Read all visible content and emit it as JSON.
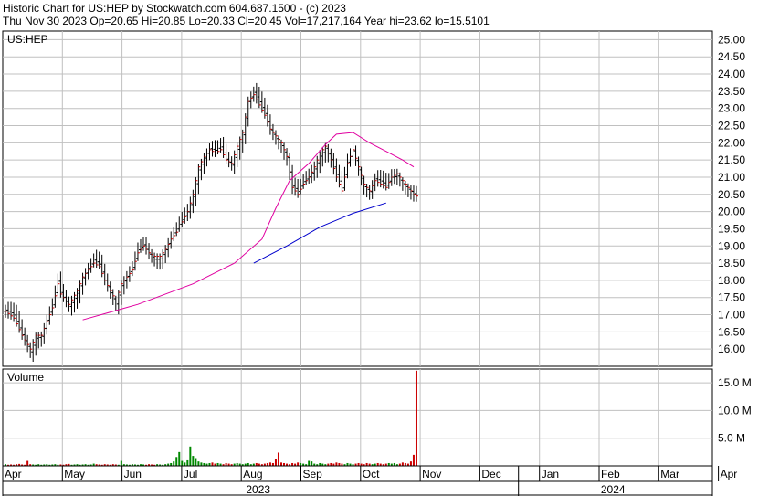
{
  "header": {
    "line1": "Historic Chart for US:HEP by Stockwatch.com 604.687.1500 - (c) 2023",
    "line2": "Thu Nov 30 2023  Op=20.65  Hi=20.85  Lo=20.33  Cl=20.45  Vol=17,217,164  Year hi=23.62  lo=15.5101"
  },
  "chart_data": {
    "type": "candlestick",
    "symbol_label": "US:HEP",
    "volume_label": "Volume",
    "price_axis": {
      "min": 15.5,
      "max": 25.25,
      "ticks": [
        "16.00",
        "16.50",
        "17.00",
        "17.50",
        "18.00",
        "18.50",
        "19.00",
        "19.50",
        "20.00",
        "20.50",
        "21.00",
        "21.50",
        "22.00",
        "22.50",
        "23.00",
        "23.50",
        "24.00",
        "24.50",
        "25.00"
      ]
    },
    "volume_axis": {
      "max_millions": 17.5,
      "ticks": [
        {
          "value": 5,
          "label": "5.0 M"
        },
        {
          "value": 10,
          "label": "10.0 M"
        },
        {
          "value": 15,
          "label": "15.0 M"
        }
      ]
    },
    "months": [
      "Apr",
      "May",
      "Jun",
      "Jul",
      "Aug",
      "Sep",
      "Oct",
      "Nov",
      "Dec",
      "Jan",
      "Feb",
      "Mar",
      "Apr"
    ],
    "years": [
      "2023",
      "2024"
    ],
    "grid": true,
    "price_path": [
      [
        0,
        17.1
      ],
      [
        3,
        16.9
      ],
      [
        6,
        16.4
      ],
      [
        9,
        16.0
      ],
      [
        11,
        16.4
      ],
      [
        13,
        16.4
      ],
      [
        15,
        16.8
      ],
      [
        17,
        17.2
      ],
      [
        19,
        17.9
      ],
      [
        20,
        17.6
      ],
      [
        23,
        17.3
      ],
      [
        26,
        17.7
      ],
      [
        28,
        18.1
      ],
      [
        30,
        18.3
      ],
      [
        32,
        18.5
      ],
      [
        34,
        18.4
      ],
      [
        36,
        18.0
      ],
      [
        38,
        17.7
      ],
      [
        40,
        17.4
      ],
      [
        42,
        17.9
      ],
      [
        44,
        18.1
      ],
      [
        46,
        18.3
      ],
      [
        48,
        18.8
      ],
      [
        50,
        19.0
      ],
      [
        52,
        18.8
      ],
      [
        54,
        18.7
      ],
      [
        56,
        18.7
      ],
      [
        58,
        18.9
      ],
      [
        60,
        19.2
      ],
      [
        62,
        19.4
      ],
      [
        64,
        19.7
      ],
      [
        66,
        20.0
      ],
      [
        68,
        20.5
      ],
      [
        70,
        21.3
      ],
      [
        72,
        21.6
      ],
      [
        74,
        21.8
      ],
      [
        76,
        21.7
      ],
      [
        78,
        21.8
      ],
      [
        80,
        21.5
      ],
      [
        82,
        21.4
      ],
      [
        84,
        21.9
      ],
      [
        86,
        22.3
      ],
      [
        88,
        23.2
      ],
      [
        90,
        23.4
      ],
      [
        92,
        23.1
      ],
      [
        94,
        22.8
      ],
      [
        96,
        22.4
      ],
      [
        98,
        22.2
      ],
      [
        100,
        22.0
      ],
      [
        102,
        21.6
      ],
      [
        104,
        20.7
      ],
      [
        106,
        20.5
      ],
      [
        108,
        20.8
      ],
      [
        110,
        21.0
      ],
      [
        112,
        21.3
      ],
      [
        114,
        21.7
      ],
      [
        116,
        21.9
      ],
      [
        118,
        21.5
      ],
      [
        120,
        21.0
      ],
      [
        122,
        20.6
      ],
      [
        124,
        21.4
      ],
      [
        126,
        21.8
      ],
      [
        128,
        21.3
      ],
      [
        130,
        20.8
      ],
      [
        132,
        20.6
      ],
      [
        134,
        20.9
      ],
      [
        136,
        20.8
      ],
      [
        138,
        20.7
      ],
      [
        140,
        21.0
      ],
      [
        142,
        21.1
      ],
      [
        144,
        20.9
      ],
      [
        146,
        20.7
      ],
      [
        148,
        20.5
      ],
      [
        149,
        20.45
      ]
    ],
    "ma_short": [
      [
        0,
        16.85
      ],
      [
        20,
        17.3
      ],
      [
        40,
        17.9
      ],
      [
        55,
        18.5
      ],
      [
        65,
        19.2
      ],
      [
        70,
        20.1
      ],
      [
        75,
        20.9
      ],
      [
        82,
        21.4
      ],
      [
        88,
        21.95
      ],
      [
        92,
        22.25
      ],
      [
        98,
        22.3
      ],
      [
        104,
        22.0
      ],
      [
        110,
        21.75
      ],
      [
        116,
        21.5
      ],
      [
        120,
        21.3
      ],
      [
        126,
        21.2
      ],
      [
        132,
        21.0
      ],
      [
        136,
        21.15
      ],
      [
        140,
        21.1
      ],
      [
        144,
        21.05
      ],
      [
        149,
        21.0
      ]
    ],
    "ma_long": [
      [
        0,
        18.5
      ],
      [
        12,
        19.0
      ],
      [
        24,
        19.55
      ],
      [
        36,
        19.95
      ],
      [
        48,
        20.25
      ],
      [
        60,
        20.5
      ],
      [
        72,
        20.75
      ],
      [
        84,
        21.0
      ],
      [
        96,
        21.15
      ],
      [
        108,
        21.25
      ],
      [
        120,
        21.3
      ],
      [
        126,
        21.32
      ]
    ],
    "volume_millions": [
      0.3,
      0.2,
      0.25,
      0.2,
      0.3,
      0.35,
      0.25,
      0.2,
      0.9,
      0.3,
      0.25,
      0.2,
      0.3,
      0.2,
      0.25,
      0.3,
      0.2,
      0.25,
      0.3,
      0.2,
      0.25,
      0.2,
      0.3,
      0.35,
      0.2,
      0.25,
      0.3,
      0.2,
      0.25,
      0.3,
      0.2,
      0.25,
      0.4,
      0.3,
      0.25,
      0.2,
      0.3,
      0.25,
      0.2,
      0.3,
      0.25,
      0.2,
      0.9,
      0.3,
      0.25,
      0.2,
      0.3,
      0.25,
      0.2,
      0.3,
      0.25,
      0.2,
      0.3,
      0.25,
      0.2,
      0.3,
      0.25,
      0.2,
      0.3,
      0.4,
      0.5,
      0.8,
      1.6,
      2.5,
      0.9,
      0.6,
      1.0,
      3.5,
      1.8,
      1.4,
      0.8,
      0.6,
      0.5,
      0.4,
      0.5,
      0.6,
      0.4,
      0.5,
      0.4,
      0.3,
      0.5,
      0.4,
      0.3,
      0.4,
      0.5,
      0.4,
      0.3,
      0.4,
      0.5,
      0.3,
      0.4,
      0.5,
      0.4,
      0.3,
      0.4,
      0.5,
      0.6,
      0.5,
      1.2,
      2.4,
      0.6,
      0.5,
      0.4,
      0.3,
      0.5,
      0.4,
      0.6,
      0.5,
      0.4,
      0.3,
      0.9,
      0.8,
      0.4,
      0.3,
      0.5,
      0.4,
      0.3,
      0.4,
      0.5,
      0.4,
      0.6,
      0.5,
      0.4,
      0.3,
      0.5,
      0.4,
      0.3,
      0.4,
      0.5,
      0.4,
      0.3,
      0.5,
      0.4,
      0.3,
      0.4,
      0.5,
      0.4,
      0.3,
      0.4,
      0.5,
      0.4,
      0.5,
      0.3,
      0.4,
      0.6,
      0.5,
      0.4,
      0.8,
      2.0,
      17.2
    ],
    "colors": {
      "up": "#008800",
      "down": "#cc0000",
      "ma_short": "#e000a0",
      "ma_long": "#0000cc",
      "candle": "#000000",
      "grid": "#c0c0c0"
    }
  }
}
